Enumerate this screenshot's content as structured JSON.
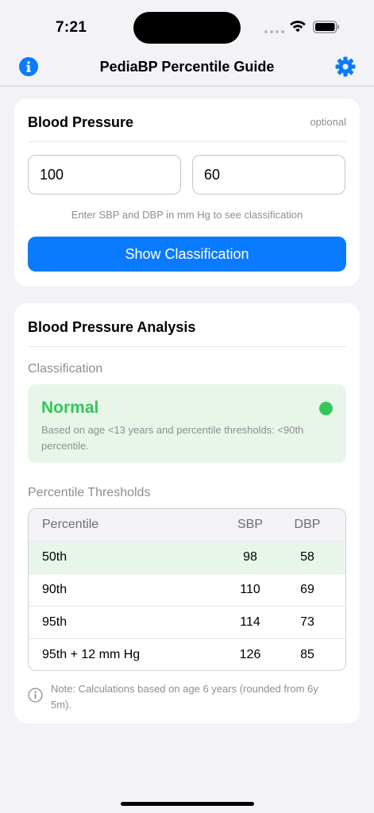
{
  "status_bar": {
    "time": "7:21"
  },
  "nav": {
    "title": "PediaBP Percentile Guide",
    "info_icon": "info-icon",
    "settings_icon": "gear-icon",
    "accent_color": "#0A7AFF"
  },
  "bp_card": {
    "title": "Blood Pressure",
    "optional_label": "optional",
    "sbp_value": "100",
    "dbp_value": "60",
    "hint": "Enter SBP and DBP in mm Hg to see classification",
    "button_label": "Show Classification"
  },
  "analysis_card": {
    "title": "Blood Pressure Analysis",
    "classification_label": "Classification",
    "status": "Normal",
    "status_color": "#34C759",
    "status_description": "Based on age <13 years and percentile thresholds: <90th percentile.",
    "thresholds_label": "Percentile Thresholds",
    "table": {
      "headers": [
        "Percentile",
        "SBP",
        "DBP"
      ],
      "rows": [
        [
          "50th",
          "98",
          "58"
        ],
        [
          "90th",
          "110",
          "69"
        ],
        [
          "95th",
          "114",
          "73"
        ],
        [
          "95th + 12 mm Hg",
          "126",
          "85"
        ]
      ]
    },
    "note": "Note: Calculations based on age 6 years (rounded from 6y 5m)."
  }
}
